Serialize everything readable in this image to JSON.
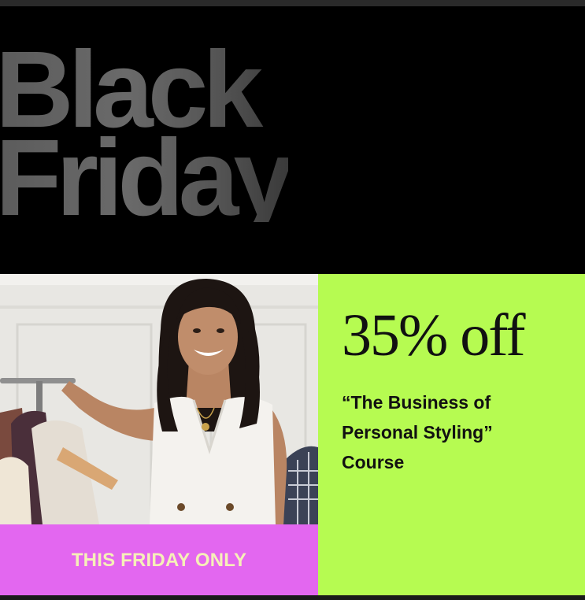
{
  "banner": {
    "headline_line1": "Black",
    "headline_line2": "Friday"
  },
  "offer": {
    "discount": "35% off",
    "course_line1": "“The Business of",
    "course_line2": "Personal Styling”",
    "course_line3": "Course"
  },
  "badge": {
    "label": "THIS FRIDAY ONLY"
  },
  "colors": {
    "background": "#000000",
    "offer_panel": "#b6fb51",
    "badge": "#e367f0",
    "badge_text": "#f6f0b8"
  }
}
